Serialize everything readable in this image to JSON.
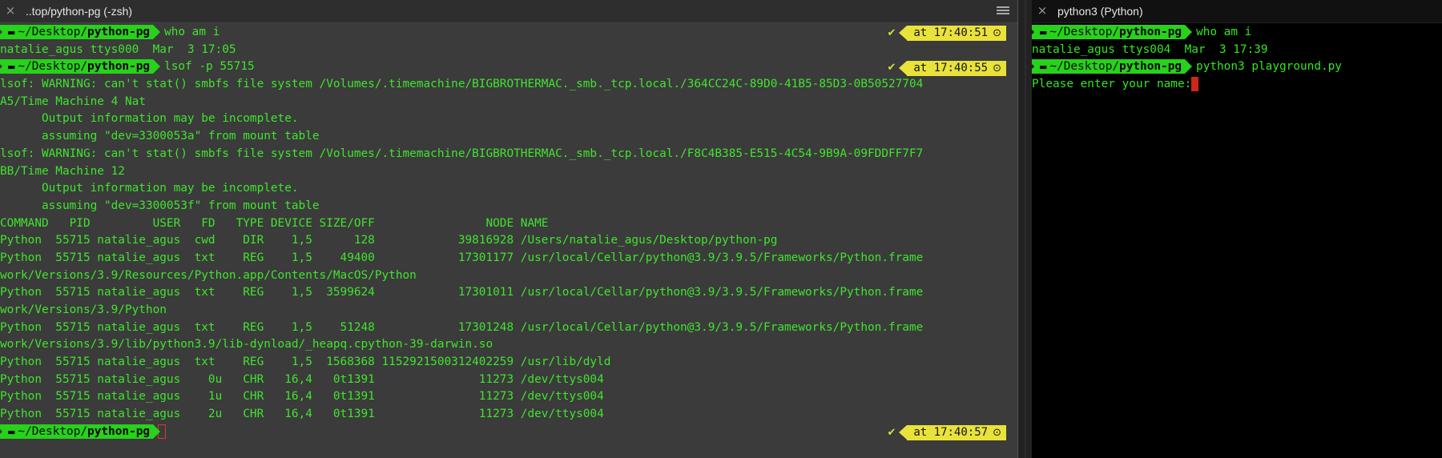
{
  "left_pane": {
    "title": "..top/python-pg (-zsh)",
    "close_icon": "×",
    "menu_icon": "hamburger-menu",
    "lines": [
      {
        "type": "prompt",
        "path": "~/Desktop/",
        "bold": "python-pg",
        "cmd": "who am i",
        "time": "at 17:40:51",
        "check": "✔"
      },
      {
        "type": "text",
        "text": "natalie_agus ttys000  Mar  3 17:05"
      },
      {
        "type": "prompt",
        "path": "~/Desktop/",
        "bold": "python-pg",
        "cmd": "lsof -p 55715",
        "time": "at 17:40:55",
        "check": "✔"
      },
      {
        "type": "text",
        "text": "lsof: WARNING: can't stat() smbfs file system /Volumes/.timemachine/BIGBROTHERMAC._smb._tcp.local./364CC24C-89D0-41B5-85D3-0B50527704"
      },
      {
        "type": "text",
        "text": "A5/Time Machine 4 Nat"
      },
      {
        "type": "text",
        "text": "      Output information may be incomplete."
      },
      {
        "type": "text",
        "text": "      assuming \"dev=3300053a\" from mount table"
      },
      {
        "type": "text",
        "text": "lsof: WARNING: can't stat() smbfs file system /Volumes/.timemachine/BIGBROTHERMAC._smb._tcp.local./F8C4B385-E515-4C54-9B9A-09FDDFF7F7"
      },
      {
        "type": "text",
        "text": "BB/Time Machine 12"
      },
      {
        "type": "text",
        "text": "      Output information may be incomplete."
      },
      {
        "type": "text",
        "text": "      assuming \"dev=3300053f\" from mount table"
      },
      {
        "type": "text",
        "text": "COMMAND   PID         USER   FD   TYPE DEVICE SIZE/OFF                NODE NAME"
      },
      {
        "type": "text",
        "text": "Python  55715 natalie_agus  cwd    DIR    1,5      128            39816928 /Users/natalie_agus/Desktop/python-pg"
      },
      {
        "type": "text",
        "text": "Python  55715 natalie_agus  txt    REG    1,5    49400            17301177 /usr/local/Cellar/python@3.9/3.9.5/Frameworks/Python.frame"
      },
      {
        "type": "text",
        "text": "work/Versions/3.9/Resources/Python.app/Contents/MacOS/Python"
      },
      {
        "type": "text",
        "text": "Python  55715 natalie_agus  txt    REG    1,5  3599624            17301011 /usr/local/Cellar/python@3.9/3.9.5/Frameworks/Python.frame"
      },
      {
        "type": "text",
        "text": "work/Versions/3.9/Python"
      },
      {
        "type": "text",
        "text": "Python  55715 natalie_agus  txt    REG    1,5    51248            17301248 /usr/local/Cellar/python@3.9/3.9.5/Frameworks/Python.frame"
      },
      {
        "type": "text",
        "text": "work/Versions/3.9/lib/python3.9/lib-dynload/_heapq.cpython-39-darwin.so"
      },
      {
        "type": "text",
        "text": "Python  55715 natalie_agus  txt    REG    1,5  1568368 1152921500312402259 /usr/lib/dyld"
      },
      {
        "type": "text",
        "text": "Python  55715 natalie_agus    0u   CHR   16,4   0t1391               11273 /dev/ttys004"
      },
      {
        "type": "text",
        "text": "Python  55715 natalie_agus    1u   CHR   16,4   0t1391               11273 /dev/ttys004"
      },
      {
        "type": "text",
        "text": "Python  55715 natalie_agus    2u   CHR   16,4   0t1391               11273 /dev/ttys004"
      },
      {
        "type": "prompt",
        "path": "~/Desktop/",
        "bold": "python-pg",
        "cmd": "",
        "time": "at 17:40:57",
        "check": "✔",
        "cursor": "outline"
      }
    ]
  },
  "right_pane": {
    "title": "python3 (Python)",
    "close_icon": "×",
    "lines": [
      {
        "type": "prompt",
        "path": "~/Desktop/",
        "bold": "python-pg",
        "cmd": "who am i"
      },
      {
        "type": "text",
        "text": "natalie_agus ttys004  Mar  3 17:39"
      },
      {
        "type": "prompt",
        "path": "~/Desktop/",
        "bold": "python-pg",
        "cmd": "python3 playground.py"
      },
      {
        "type": "text",
        "text": "Please enter your name:",
        "cursor": "solid"
      }
    ]
  },
  "colors": {
    "prompt_green": "#27d21a",
    "text_green": "#3fe42d",
    "time_yellow": "#e9e23a",
    "apple_red": "#f1453d",
    "left_bg": "#3b3b3b",
    "right_bg": "#000000"
  }
}
